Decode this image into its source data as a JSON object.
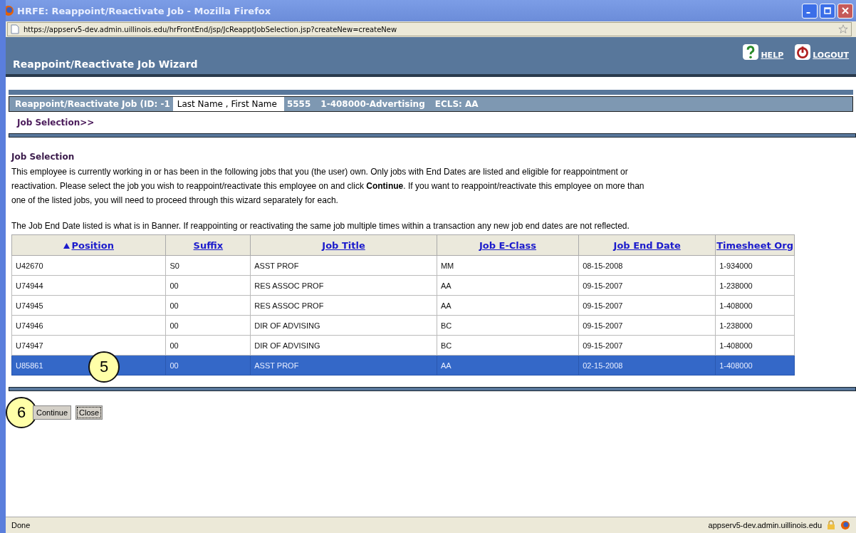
{
  "window": {
    "title": "HRFE: Reappoint/Reactivate Job - Mozilla Firefox"
  },
  "address_bar": {
    "url": "https://appserv5-dev.admin.uillinois.edu/hrFrontEnd/jsp/JcReapptJobSelection.jsp?createNew=createNew"
  },
  "header": {
    "title": "Reappoint/Reactivate Job Wizard",
    "links": [
      "HELP",
      "LOGOUT"
    ]
  },
  "job_bar": {
    "prefix": "Reappoint/Reactivate Job (ID: -1",
    "name": "Last Name , First Name",
    "suffix": "5555",
    "org": "1-408000-Advertising",
    "ecls": "ECLS: AA"
  },
  "breadcrumb": "Job Selection>>",
  "section": {
    "title": "Job Selection",
    "paragraphs": [
      "This employee is currently working in or has been in the following jobs that you (the user) own. Only jobs with End Dates are listed and eligible for reappointment or reactivation. Please select the job you wish to reappoint/reactivate this employee on and click **Continue**. If you want to reappoint/reactivate this employee on more than one of the listed jobs, you will need to proceed through this wizard separately for each.",
      "The Job End Date listed is what is in Banner. If reappointing or reactivating the same job multiple times within a transaction any new job end dates are not reflected."
    ]
  },
  "table": {
    "columns": [
      {
        "label": "Position",
        "sorted": true
      },
      {
        "label": "Suffix",
        "sorted": false
      },
      {
        "label": "Job Title",
        "sorted": false
      },
      {
        "label": "Job E-Class",
        "sorted": false
      },
      {
        "label": "Job End Date",
        "sorted": false
      },
      {
        "label": "Timesheet Org",
        "sorted": false
      }
    ],
    "rows": [
      {
        "cells": [
          "U42670",
          "S0",
          "ASST PROF",
          "MM",
          "08-15-2008",
          "1-934000"
        ],
        "selected": false
      },
      {
        "cells": [
          "U74944",
          "00",
          "RES ASSOC PROF",
          "AA",
          "09-15-2007",
          "1-238000"
        ],
        "selected": false
      },
      {
        "cells": [
          "U74945",
          "00",
          "RES ASSOC PROF",
          "AA",
          "09-15-2007",
          "1-408000"
        ],
        "selected": false
      },
      {
        "cells": [
          "U74946",
          "00",
          "DIR OF ADVISING",
          "BC",
          "09-15-2007",
          "1-238000"
        ],
        "selected": false
      },
      {
        "cells": [
          "U74947",
          "00",
          "DIR OF ADVISING",
          "BC",
          "09-15-2007",
          "1-408000"
        ],
        "selected": false
      },
      {
        "cells": [
          "U85861",
          "00",
          "ASST PROF",
          "AA",
          "02-15-2008",
          "1-408000"
        ],
        "selected": true
      }
    ]
  },
  "buttons": [
    {
      "label": "Continue",
      "focused": false
    },
    {
      "label": "Close",
      "focused": true
    }
  ],
  "callouts": [
    "5",
    "6"
  ],
  "status_bar": {
    "text": "Done",
    "host": "appserv5-dev.admin.uillinois.edu"
  }
}
